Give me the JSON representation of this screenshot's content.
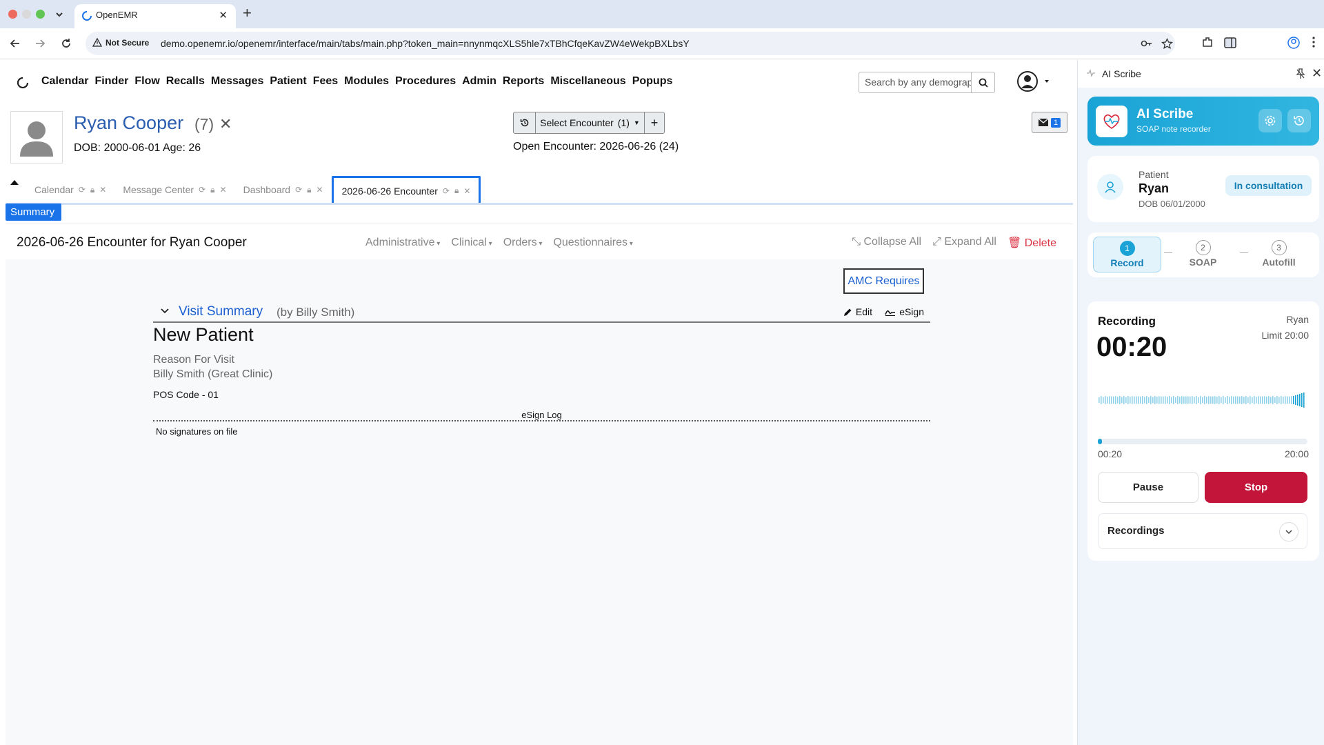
{
  "browser": {
    "tab_title": "OpenEMR",
    "not_secure": "Not Secure",
    "url": "demo.openemr.io/openemr/interface/main/tabs/main.php?token_main=nnynmqcXLS5hle7xTBhCfqeKavZW4eWekpBXLbsY"
  },
  "nav": {
    "menu": [
      "Calendar",
      "Finder",
      "Flow",
      "Recalls",
      "Messages",
      "Patient",
      "Fees",
      "Modules",
      "Procedures",
      "Admin",
      "Reports",
      "Miscellaneous",
      "Popups"
    ],
    "search_placeholder": "Search by any demographics"
  },
  "patient": {
    "name": "Ryan Cooper",
    "id": "(7)",
    "dob_line": "DOB: 2000-06-01 Age: 26"
  },
  "encounter_selector": {
    "label": "Select Encounter",
    "count": "(1)",
    "open_encounter": "Open Encounter: 2026-06-26 (24)"
  },
  "mail_count": "1",
  "app_tabs": [
    {
      "label": "Calendar"
    },
    {
      "label": "Message Center"
    },
    {
      "label": "Dashboard"
    },
    {
      "label": "2026-06-26 Encounter"
    }
  ],
  "summary_label": "Summary",
  "encounter": {
    "title": "2026-06-26 Encounter for Ryan Cooper",
    "menus": [
      "Administrative",
      "Clinical",
      "Orders",
      "Questionnaires"
    ],
    "collapse_all": "Collapse All",
    "expand_all": "Expand All",
    "delete": "Delete",
    "amc": "AMC Requires",
    "visit_summary": "Visit Summary",
    "visit_by": "(by Billy Smith)",
    "edit": "Edit",
    "esign": "eSign",
    "visit_type": "New Patient",
    "reason": "Reason For Visit",
    "provider": "Billy Smith (Great Clinic)",
    "pos": "POS Code - 01",
    "esign_log": "eSign Log",
    "no_signatures": "No signatures on file"
  },
  "scribe": {
    "panel_label": "AI Scribe",
    "title": "AI Scribe",
    "subtitle": "SOAP note recorder",
    "patient_label": "Patient",
    "patient_name": "Ryan",
    "patient_dob": "DOB 06/01/2000",
    "status": "In consultation",
    "steps": [
      {
        "num": "1",
        "label": "Record"
      },
      {
        "num": "2",
        "label": "SOAP"
      },
      {
        "num": "3",
        "label": "Autofill"
      }
    ],
    "recording_label": "Recording",
    "elapsed": "00:20",
    "user": "Ryan",
    "limit": "Limit 20:00",
    "progress_fraction": 0.017,
    "progress_start": "00:20",
    "progress_end": "20:00",
    "pause": "Pause",
    "stop": "Stop",
    "recordings": "Recordings",
    "accent": "#1aa3d6",
    "stop_color": "#c3153a"
  }
}
